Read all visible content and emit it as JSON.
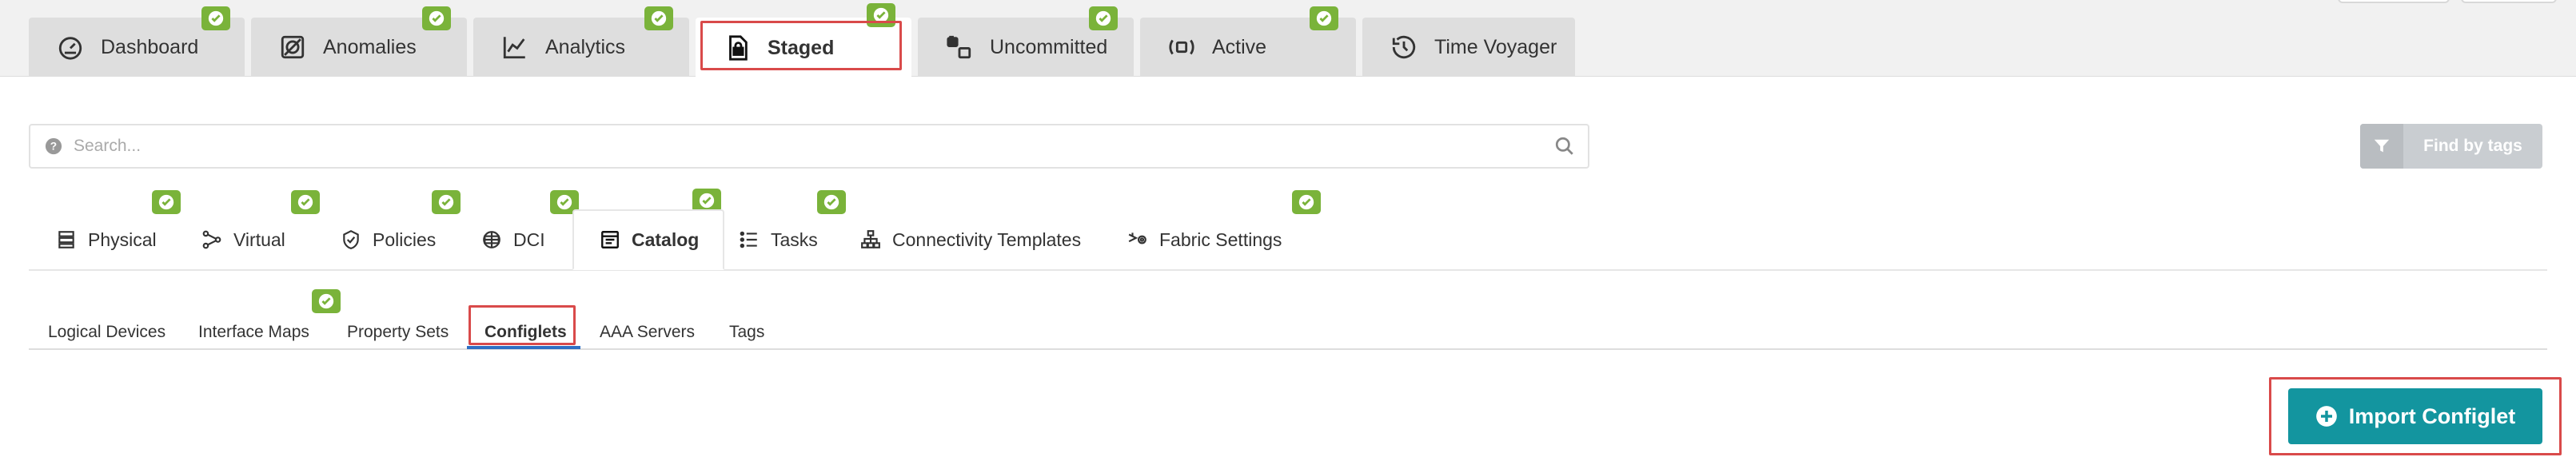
{
  "colors": {
    "accent": "#13959f",
    "status_ok": "#7ab33a",
    "highlight": "#d94a4a",
    "underline": "#2e6fc4"
  },
  "top_tabs": [
    {
      "label": "Dashboard",
      "icon": "gauge-icon"
    },
    {
      "label": "Anomalies",
      "icon": "anomaly-icon"
    },
    {
      "label": "Analytics",
      "icon": "line-chart-icon"
    },
    {
      "label": "Staged",
      "icon": "locked-document-icon",
      "active": true
    },
    {
      "label": "Uncommitted",
      "icon": "uncommitted-icon"
    },
    {
      "label": "Active",
      "icon": "active-broadcast-icon"
    },
    {
      "label": "Time Voyager",
      "icon": "history-icon"
    }
  ],
  "search": {
    "placeholder": "Search..."
  },
  "find_by_tags": {
    "label": "Find by tags",
    "icon": "filter-icon"
  },
  "section_tabs": [
    {
      "label": "Physical",
      "icon": "rack-icon"
    },
    {
      "label": "Virtual",
      "icon": "virtual-network-icon"
    },
    {
      "label": "Policies",
      "icon": "shield-check-icon"
    },
    {
      "label": "DCI",
      "icon": "dci-icon"
    },
    {
      "label": "Catalog",
      "icon": "catalog-icon",
      "active": true
    },
    {
      "label": "Tasks",
      "icon": "task-list-icon"
    },
    {
      "label": "Connectivity Templates",
      "icon": "hierarchy-icon"
    },
    {
      "label": "Fabric Settings",
      "icon": "fabric-settings-icon"
    }
  ],
  "catalog_tabs": [
    {
      "label": "Logical Devices"
    },
    {
      "label": "Interface Maps"
    },
    {
      "label": "Property Sets"
    },
    {
      "label": "Configlets",
      "active": true
    },
    {
      "label": "AAA Servers"
    },
    {
      "label": "Tags"
    }
  ],
  "import_button": {
    "label": "Import Configlet",
    "icon": "plus-circle-icon"
  }
}
